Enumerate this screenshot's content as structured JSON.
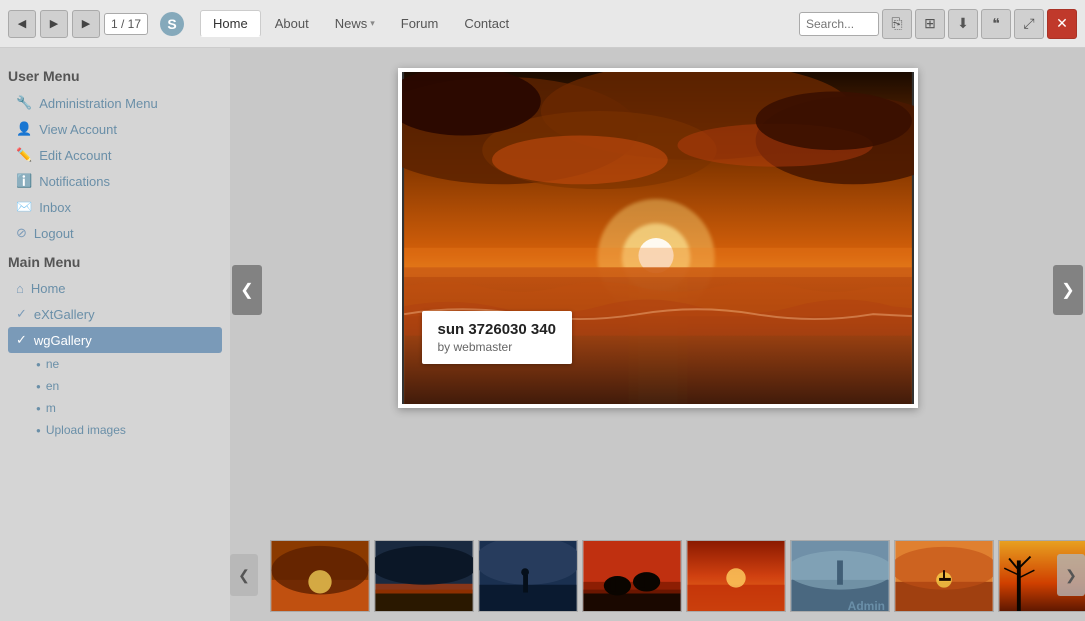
{
  "topbar": {
    "prev_label": "◀",
    "play_label": "▶",
    "next_label": "▶",
    "page_counter": "1 / 17",
    "nav_links": [
      {
        "label": "Home",
        "active": true,
        "has_dropdown": false
      },
      {
        "label": "About",
        "active": false,
        "has_dropdown": false
      },
      {
        "label": "News",
        "active": false,
        "has_dropdown": true
      },
      {
        "label": "Forum",
        "active": false,
        "has_dropdown": false
      },
      {
        "label": "Contact",
        "active": false,
        "has_dropdown": false
      }
    ],
    "search_placeholder": "Search...",
    "toolbar_icons": [
      "share",
      "grid",
      "download",
      "quote",
      "fullscreen",
      "close"
    ]
  },
  "sidebar": {
    "user_menu_title": "User Menu",
    "user_menu_items": [
      {
        "label": "Administration Menu",
        "icon": "🔧"
      },
      {
        "label": "View Account",
        "icon": "👤"
      },
      {
        "label": "Edit Account",
        "icon": "✏️"
      },
      {
        "label": "Notifications",
        "icon": "ℹ️"
      },
      {
        "label": "Inbox",
        "icon": "✉️"
      },
      {
        "label": "Logout",
        "icon": "⊘"
      }
    ],
    "main_menu_title": "Main Menu",
    "main_menu_items": [
      {
        "label": "Home",
        "icon": "⌂",
        "active": false
      },
      {
        "label": "eXtGallery",
        "icon": "✓",
        "active": false
      },
      {
        "label": "wgGallery",
        "icon": "✓",
        "active": true
      }
    ],
    "sub_items": [
      {
        "label": "ne"
      },
      {
        "label": "en"
      },
      {
        "label": "m"
      },
      {
        "label": "Upload images"
      }
    ]
  },
  "gallery": {
    "main_image_title": "sun 3726030 340",
    "main_image_author": "by webmaster",
    "prev_arrow": "❮",
    "next_arrow": "❯",
    "strip_prev": "❮",
    "strip_next": "❯",
    "admin_label": "Admin",
    "thumbnails": [
      {
        "color1": "#c0392b",
        "#color2": "#e67e22",
        "type": "sunset1"
      },
      {
        "color1": "#2c3e50",
        "color2": "#3498db",
        "type": "night"
      },
      {
        "color1": "#1a1a2e",
        "color2": "#4a6fa5",
        "type": "dark-sky"
      },
      {
        "color1": "#8b0000",
        "color2": "#222",
        "type": "horses"
      },
      {
        "color1": "#e74c3c",
        "color2": "#f39c12",
        "type": "orange-sunset"
      },
      {
        "color1": "#5b8fa8",
        "color2": "#a8c8d8",
        "type": "misty"
      },
      {
        "color1": "#3d5a6e",
        "color2": "#7fa8b8",
        "type": "ship"
      },
      {
        "color1": "#e8a020",
        "color2": "#c05010",
        "type": "warm-sunset"
      },
      {
        "color1": "#888",
        "color2": "#ccc",
        "type": "gray"
      }
    ]
  }
}
